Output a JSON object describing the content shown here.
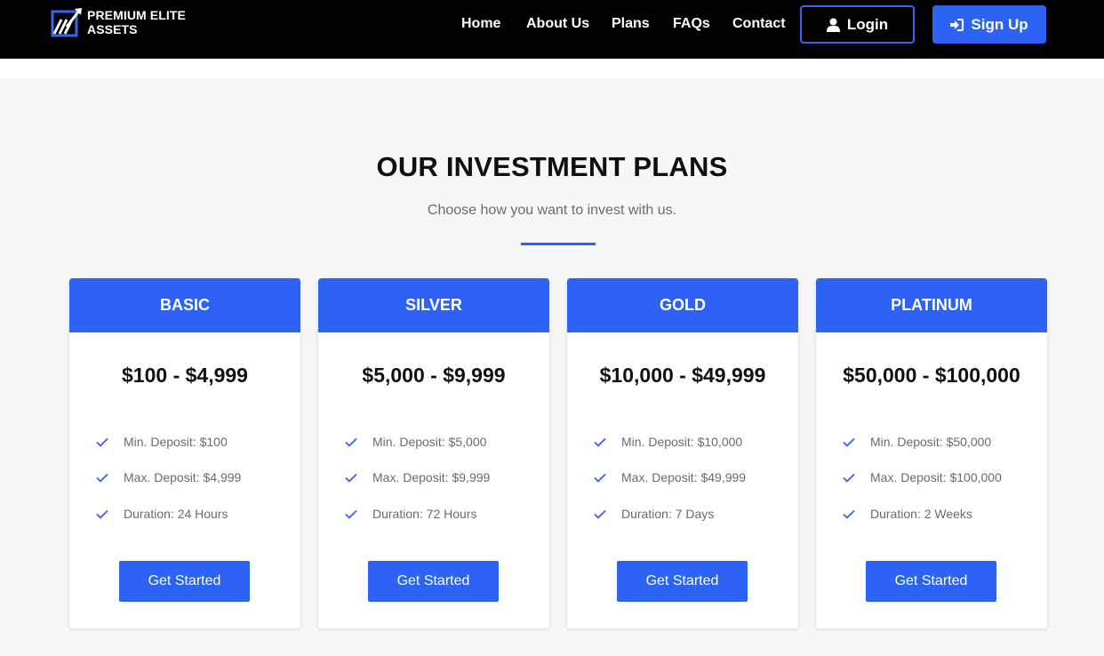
{
  "brand": {
    "line1": "PREMIUM ELITE",
    "line2": "ASSETS",
    "icon": "logo-chart-icon"
  },
  "nav": {
    "links": [
      "Home",
      "About Us",
      "Plans",
      "FAQs",
      "Contact"
    ],
    "login": {
      "label": "Login",
      "icon": "user-icon"
    },
    "signup": {
      "label": "Sign Up",
      "icon": "sign-in-icon"
    }
  },
  "section": {
    "title": "OUR INVESTMENT PLANS",
    "subtitle": "Choose how you want to invest with us."
  },
  "colors": {
    "accent": "#2d63f4",
    "header_bg": "#000000",
    "page_bg": "#f7f7f7"
  },
  "plans": [
    {
      "name": "BASIC",
      "range": "$100 - $4,999",
      "features": [
        "Min. Deposit: $100",
        "Max. Deposit: $4,999",
        "Duration: 24 Hours"
      ],
      "button": "Get Started"
    },
    {
      "name": "SILVER",
      "range": "$5,000 - $9,999",
      "features": [
        "Min. Deposit: $5,000",
        "Max. Deposit: $9,999",
        "Duration: 72 Hours"
      ],
      "button": "Get Started"
    },
    {
      "name": "GOLD",
      "range": "$10,000 - $49,999",
      "features": [
        "Min. Deposit: $10,000",
        "Max. Deposit: $49,999",
        "Duration: 7 Days"
      ],
      "button": "Get Started"
    },
    {
      "name": "PLATINUM",
      "range": "$50,000 - $100,000",
      "features": [
        "Min. Deposit: $50,000",
        "Max. Deposit: $100,000",
        "Duration: 2 Weeks"
      ],
      "button": "Get Started"
    }
  ]
}
